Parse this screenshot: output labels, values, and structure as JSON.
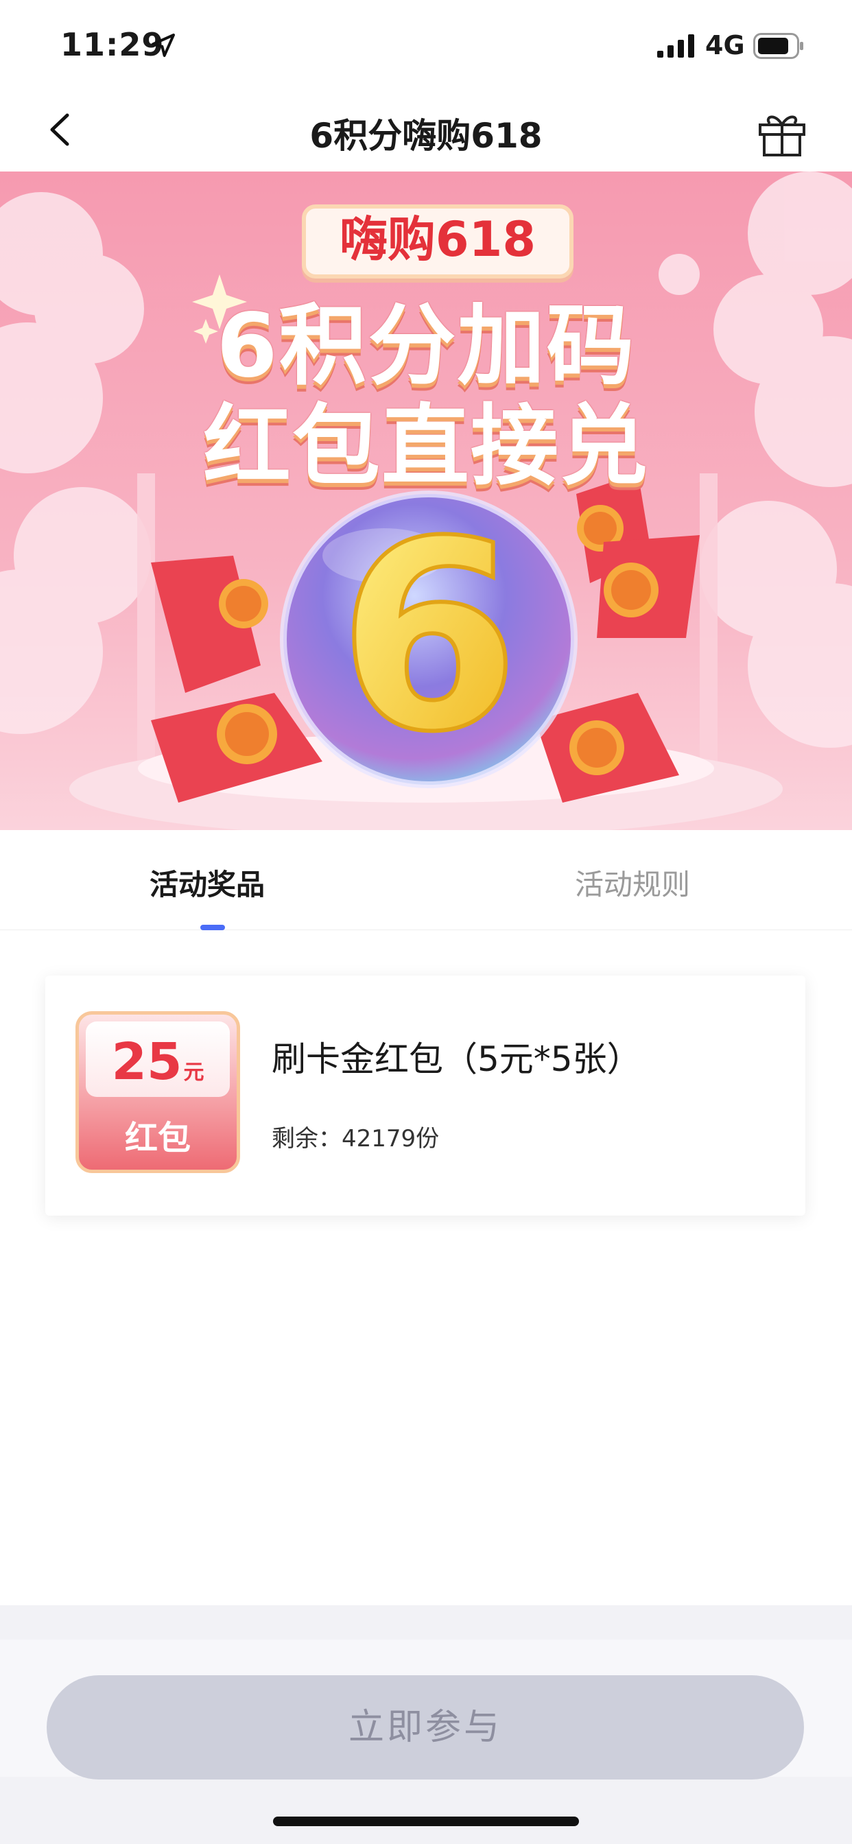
{
  "status_bar": {
    "time": "11:29",
    "network": "4G"
  },
  "nav": {
    "title": "6积分嗨购618"
  },
  "banner": {
    "tag": "嗨购618",
    "headline_line1": "6积分加码",
    "headline_line2": "红包直接兑",
    "big_number": "6"
  },
  "tabs": [
    {
      "label": "活动奖品",
      "active": true
    },
    {
      "label": "活动规则",
      "active": false
    }
  ],
  "prize": {
    "coupon_amount": "25",
    "coupon_unit": "元",
    "coupon_label": "红包",
    "title": "刷卡金红包（5元*5张）",
    "remaining": "剩余：42179份"
  },
  "bottom": {
    "join_label": "立即参与"
  },
  "colors": {
    "accent_blue": "#4a6cf7",
    "coupon_red": "#e83845",
    "disabled_button": "#cdcfdb"
  }
}
